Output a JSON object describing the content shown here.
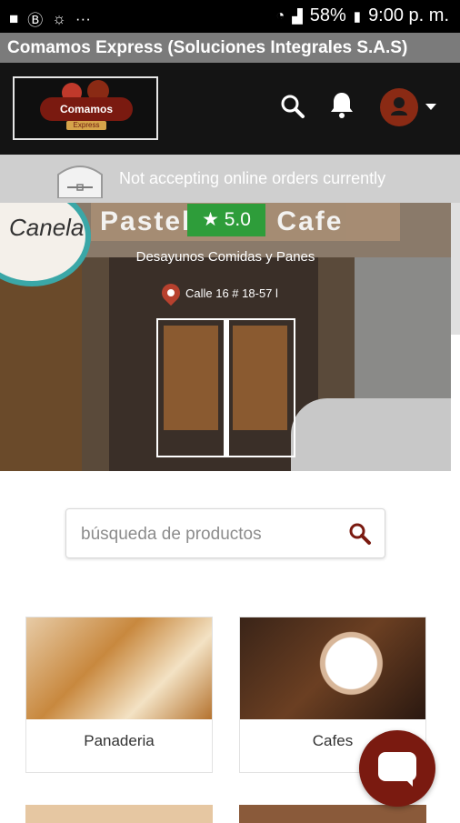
{
  "status_bar": {
    "battery": "58%",
    "time": "9:00 p. m."
  },
  "app": {
    "title": "Comamos Express (Soluciones Integrales S.A.S)"
  },
  "header": {
    "logo_text": "Comamos",
    "logo_sub": "Express"
  },
  "notice": {
    "text": "Not accepting online orders currently"
  },
  "store": {
    "rating": "5.0",
    "categories": "Desayunos Comidas y Panes",
    "address": "Calle 16 # 18-57 l",
    "sign_text": "Pastelería · Cafe",
    "sign_logo": "Canela"
  },
  "search": {
    "placeholder": "búsqueda de productos"
  },
  "categories": [
    {
      "label": "Panaderia",
      "icon": "bread-image"
    },
    {
      "label": "Cafes",
      "icon": "coffee-image"
    }
  ],
  "colors": {
    "brand": "#7a1a10",
    "rating_green": "#2e9d3a",
    "header_bg": "#141414",
    "appbar_bg": "#7b7b7b"
  }
}
